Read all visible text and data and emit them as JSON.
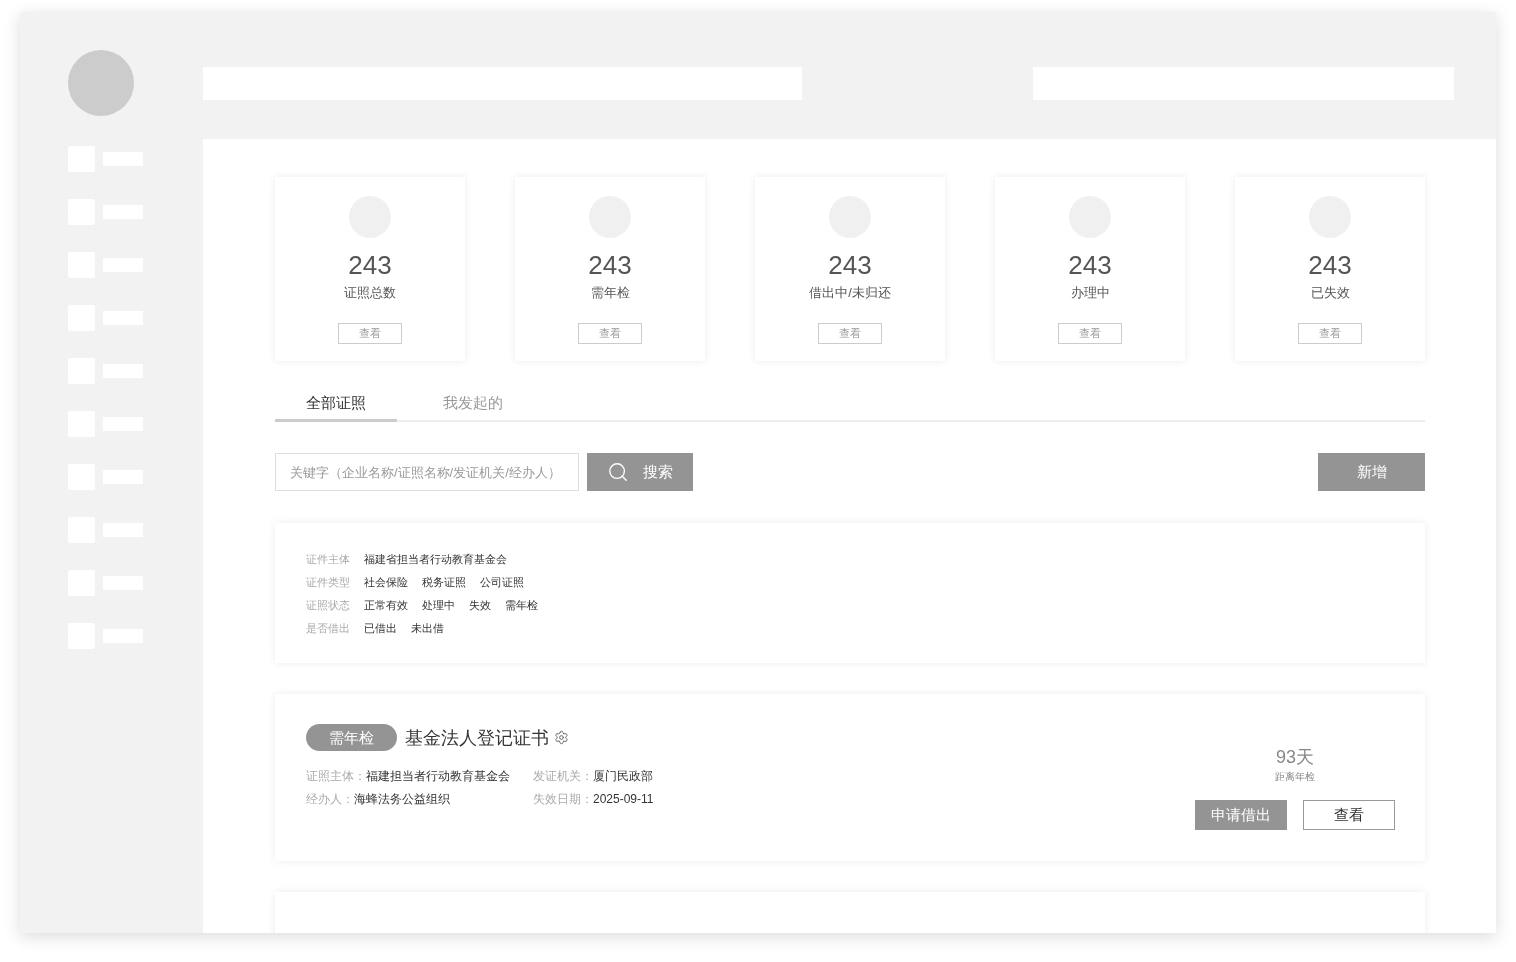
{
  "stats": [
    {
      "value": "243",
      "label": "证照总数",
      "button": "查看"
    },
    {
      "value": "243",
      "label": "需年检",
      "button": "查看"
    },
    {
      "value": "243",
      "label": "借出中/未归还",
      "button": "查看"
    },
    {
      "value": "243",
      "label": "办理中",
      "button": "查看"
    },
    {
      "value": "243",
      "label": "已失效",
      "button": "查看"
    }
  ],
  "tabs": [
    {
      "label": "全部证照",
      "selected": true
    },
    {
      "label": "我发起的",
      "selected": false
    }
  ],
  "search": {
    "placeholder": "关键字（企业名称/证照名称/发证机关/经办人）",
    "button": "搜索"
  },
  "add_button": "新增",
  "filters": [
    {
      "label": "证件主体",
      "options": [
        "福建省担当者行动教育基金会"
      ]
    },
    {
      "label": "证件类型",
      "options": [
        "社会保险",
        "税务证照",
        "公司证照"
      ]
    },
    {
      "label": "证照状态",
      "options": [
        "正常有效",
        "处理中",
        "失效",
        "需年检"
      ]
    },
    {
      "label": "是否借出",
      "options": [
        "已借出",
        "未出借"
      ]
    }
  ],
  "certificates": [
    {
      "status": "需年检",
      "title": "基金法人登记证书",
      "fields": [
        {
          "label": "证照主体：",
          "value": "福建担当者行动教育基金会"
        },
        {
          "label": "发证机关：",
          "value": "厦门民政部"
        },
        {
          "label": "经办人：",
          "value": "海蜂法务公益组织"
        },
        {
          "label": "失效日期：",
          "value": "2025-09-11"
        }
      ],
      "countdown": "93天",
      "countdown_label": "距离年检",
      "buttons": [
        {
          "label": "申请借出",
          "kind": "filled"
        },
        {
          "label": "查看",
          "kind": "outline"
        }
      ]
    }
  ]
}
